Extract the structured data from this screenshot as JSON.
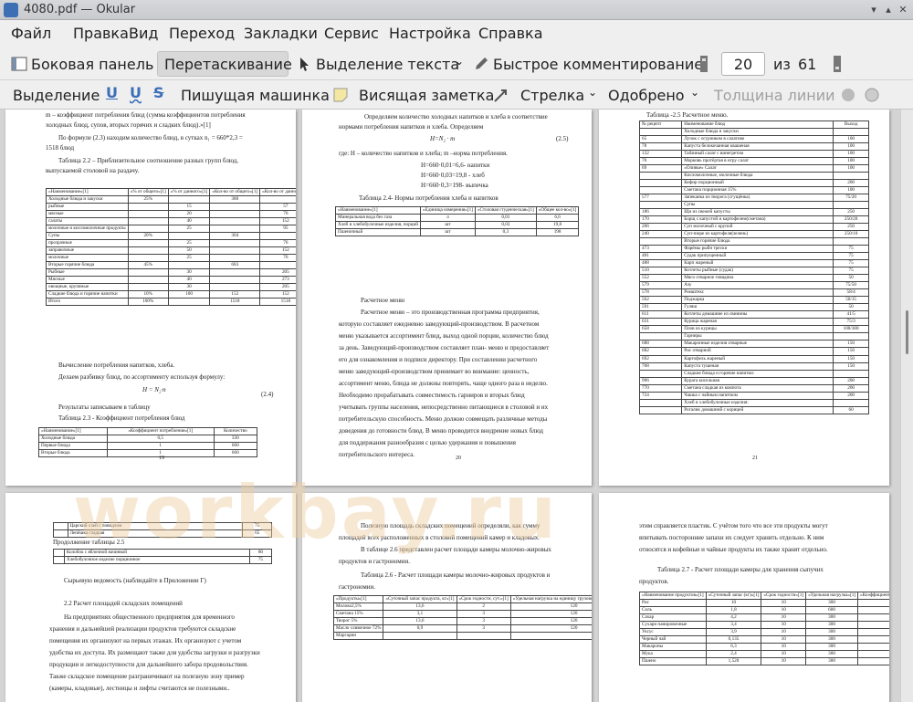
{
  "window": {
    "title": "4080.pdf — Okular"
  },
  "menu": [
    "Файл",
    "Правка",
    "Вид",
    "Переход",
    "Закладки",
    "Сервис",
    "Настройка",
    "Справка"
  ],
  "toolbar1": {
    "sidebar": "Боковая панель",
    "drag": "Перетаскивание",
    "text_select": "Выделение текста",
    "quick_comment": "Быстрое комментирование",
    "page_value": "20",
    "of": "из",
    "total": "61"
  },
  "toolbar2": {
    "select": "Выделение",
    "typewriter": "Пишущая машинка",
    "sticky_note": "Висящая заметка",
    "arrow": "Стрелка",
    "approved": "Одобрено",
    "line_width": "Толщина линии"
  },
  "watermark": "workbay.ru",
  "pages": {
    "p19": {
      "number": "19",
      "l1": "m – коэффициент потребления блюд (сумма коэффициентов потребления",
      "l2": "холодных блюд, супов, вторых горячих и сладких блюд).»[1]",
      "l3": "По формуле (2.3) находим количество блюд, в сутках n₁ = 660*2,3 =",
      "l4": "1518 блюд",
      "l5": "Таблица 2.2 – Приблизительное соотношение разных групп блюд,",
      "l6": "выпускаемой столовой на раздачу.",
      "l7": "Вычисление потребления напитков, хлеба.",
      "l8": "Делаем разбивку блюд, по ассортименту используя формулу:",
      "formula": "H = N₂·n",
      "eq": "(2.4)",
      "l9": "Результаты записываем в таблицу",
      "l10": "Таблица 2.3 - Коэффициент потребления блюд",
      "t22_head": [
        "«Наименование»[1]",
        "«% от общего»[1]",
        "«% от данного»[1]",
        "«Кол-во от общего»[1]",
        "«Кол-во от данного»[1]"
      ],
      "t22_rows": [
        [
          "Холодные блюда и закуски",
          "25%",
          "",
          "380",
          ""
        ],
        [
          "рыбные",
          "",
          "15",
          "",
          "57"
        ],
        [
          "мясные",
          "",
          "20",
          "",
          "76"
        ],
        [
          "салаты",
          "",
          "40",
          "",
          "152"
        ],
        [
          "молочные и кисломолочные продукты",
          "",
          "25",
          "",
          "95"
        ],
        [
          "Супы",
          "20%",
          "",
          "304",
          ""
        ],
        [
          "прозрачные",
          "",
          "25",
          "",
          "76"
        ],
        [
          "заправочные",
          "",
          "50",
          "",
          "152"
        ],
        [
          "молочные",
          "",
          "25",
          "",
          "76"
        ],
        [
          "Вторые горячие блюда",
          "45%",
          "",
          "683",
          ""
        ],
        [
          "Рыбные",
          "",
          "30",
          "",
          "205"
        ],
        [
          "Мясные",
          "",
          "40",
          "",
          "273"
        ],
        [
          "овощные, крупяные",
          "",
          "30",
          "",
          "205"
        ],
        [
          "Сладкие блюда и горячие напитки",
          "10%",
          "100",
          "152",
          "152"
        ],
        [
          "Итого",
          "100%",
          "",
          "1518",
          "1518"
        ]
      ],
      "t23_head": [
        "«Наименование»[1]",
        "«Коэффициент потребления»[1]",
        "Количество"
      ],
      "t23_rows": [
        [
          "Холодные блюда",
          "0,5",
          "330"
        ],
        [
          "Первые блюда",
          "1",
          "660"
        ],
        [
          "Вторые блюда",
          "1",
          "660"
        ]
      ]
    },
    "p20": {
      "number": "20",
      "l1": "Определяем количество холодных напитков и хлеба в соответствие",
      "l2": "нормами потребления напитков и хлеба. Определяем",
      "formula": "H=N₂ · m",
      "eq": "(2.5)",
      "l3": "где: H – количество напитков и хлеба; m –норма потребления.",
      "l4": "H=660·0,01=6,6- напитки",
      "l5": "H=660·0,03=19,8 - хлеб",
      "l6": "H=660·0,3=198- выпечка",
      "l7": "Таблица 2.4- Нормы потребления хлеба и напитков",
      "l8": "Расчетное меню",
      "l9": "Расчетное меню – это производственная программа предприятия,",
      "l10": "которую составляет ежедневно заведующий-производством. В расчетном",
      "l11": "меню указывается ассортимент блюд, выход одной порции, количество блюд",
      "l12": "за день. Заведующий-производством составляет план- меню и предоставляет",
      "l13": "его для ознакомления и подписи директору. При составлении расчетного",
      "l14": "меню заведующий-производством принимает во внимание: ценность,",
      "l15": "ассортимент меню, блюда не должны повторять, чаще одного раза в неделю.",
      "l16": "Необходимо прорабатывать совместимость гарниров и вторых блюд",
      "l17": "учитывать группы населения, непосредственно питающиеся в столовой и их",
      "l18": "потребительскую способность. Меню должно совмещать различные методы",
      "l19": "доведения до готовности блюд. В меню проводится внедрение новых блюд",
      "l20": "для поддержания разнообразия с целью удержания и повышения",
      "l21": "потребительского интереса.",
      "t24_head": [
        "«Наименование»[1]",
        "«Единица измерения»[1]",
        "«Столовая студенческая»[1]",
        "«Общее кол-во»[1]"
      ],
      "t24_rows": [
        [
          "Минеральная вода без газа",
          "л",
          "0,01",
          "6,6"
        ],
        [
          "Хлеб и хлебобулочные изделия, порций",
          "шт",
          "0,03",
          "19,8"
        ],
        [
          "Пшеничный",
          "шт",
          "0,3",
          "198"
        ]
      ]
    },
    "p21": {
      "number": "21",
      "l1": "Таблица -2.5 Расчетное меню.",
      "t25_head": [
        "№ рецепт",
        "Наименование блюд",
        "Выход"
      ],
      "t25_rows": [
        [
          "",
          "Холодные блюда и закуски",
          ""
        ],
        [
          "65",
          "Лучок с огурчиком в салатике",
          "100"
        ],
        [
          "78",
          "Капуста белокочанная квашеная",
          "100"
        ],
        [
          "132",
          "Табачный салат с винегретом",
          "100"
        ],
        [
          "70",
          "Морковь протёртая в игру салат",
          "100"
        ],
        [
          "69",
          "«Оливье» Салат",
          "100"
        ],
        [
          "",
          "Кисломолочные, молочные блюда",
          ""
        ],
        [
          "",
          "Кефир порционный",
          "200"
        ],
        [
          "",
          "Сметана порционная 15%",
          "100"
        ],
        [
          "577",
          "Запеканка из творога (сгущёнка)",
          "75/20"
        ],
        [
          "",
          "Супы",
          ""
        ],
        [
          "186",
          "Щи из свежей капусты",
          "250"
        ],
        [
          "170",
          "Борщ с капустой и картофелем(сметана)",
          "250/20"
        ],
        [
          "206",
          "Суп молочный с крупой",
          "250"
        ],
        [
          "240",
          "Суп-пюре из картофеля(зелень)",
          "250/10"
        ],
        [
          "",
          "Вторые горячие блюда",
          ""
        ],
        [
          "473",
          "Фарёмы рыбн трески",
          "75"
        ],
        [
          "481",
          "Судак припущенный",
          "75"
        ],
        [
          "488",
          "Карп жареный",
          "75"
        ],
        [
          "510",
          "Котлеты рыбные (судак)",
          "75"
        ],
        [
          "552",
          "Мясо отварное говядина",
          "50"
        ],
        [
          "579",
          "Азу",
          "75/50"
        ],
        [
          "578",
          "Ромштекс",
          "58/4"
        ],
        [
          "562",
          "Поджарка",
          "50/15"
        ],
        [
          "591",
          "Гуляш",
          "50"
        ],
        [
          "611",
          "Котлеты домашние из свинины",
          "41/5"
        ],
        [
          "631",
          "Курица жареная",
          "75/3"
        ],
        [
          "658",
          "Плов из курицы",
          "100/300"
        ],
        [
          "",
          "Гарниры",
          ""
        ],
        [
          "688",
          "Макаронные изделия отварные",
          "150"
        ],
        [
          "682",
          "Рис отварной",
          "150"
        ],
        [
          "692",
          "Картофель жареный",
          "150"
        ],
        [
          "708",
          "Капуста тушеная",
          "150"
        ],
        [
          "",
          "Сладкие блюда и горячие напитки:",
          ""
        ],
        [
          "996",
          "Курага кисельная",
          "200"
        ],
        [
          "770",
          "Сметана сладкая из компота",
          "200"
        ],
        [
          "724",
          "Чашка с чайным напитком",
          "200"
        ],
        [
          "",
          "Хлеб и хлебобулочные изделия:",
          ""
        ],
        [
          "",
          "Рогалик домашний с корицей",
          "60"
        ]
      ]
    },
    "p22": {
      "l1": "Продолжение таблицы 2.5",
      "l2": "Сырьевую ведомость (наблюдайте в Приложении Г)",
      "l3": "2.2 Расчет площадей складских помещений",
      "l4": "На предприятиях общественного предприятия для временного",
      "l5": "хранения и дальнейшей реализации продуктов требуются складские",
      "l6": "помещения их организуют на первых этажах. Их организуют с учетом",
      "l7": "удобства их доступа. Их размещают также для удобства загрузки и разгрузки",
      "l8": "продукции и легкодоступности для дальнейшего забора продовольствия.",
      "l9": "Также складское помещение разграничивают на полезную зону пример",
      "l10": "(камеры, кладовые), лестницы и лифты считаются не полезными..",
      "t_top": [
        [
          "",
          "Царский слей с повидлом",
          "75"
        ],
        [
          "",
          "Лепёшка сладкая",
          "65"
        ]
      ],
      "t_cont": [
        [
          "",
          "Колобок с яблочной начинкой",
          "80"
        ],
        [
          "",
          "Хлебобулочное изделие порционное",
          "75"
        ]
      ]
    },
    "p23": {
      "l1": "Полезную площадь складских помещений определяли, как сумму",
      "l2": "площадей всех расположенных в столовой помещений камер и кладовых.",
      "l3": "В таблице 2.6 представлен расчет площади камеры молочно-жировых",
      "l4": "продуктов и гастрономии.",
      "l5": "Таблица 2.6 - Расчет площади камеры молочно-жировых продуктов и",
      "l6": "гастрономии.",
      "t26_head": [
        "«Продукты»[1]",
        "«Суточный запас продукта, кг»[1]",
        "«Срок годности, сут.»[1]",
        "«Удельная нагрузка на единицу грузовой площади, кг/м²»[1]",
        "«Коэффициент увеличения площади»[1]",
        "«Площадь, м²»[1]"
      ],
      "t26_rows": [
        [
          "Молоко2,5%",
          "13,6",
          "2",
          "120",
          "2,2",
          "0,5"
        ],
        [
          "Сметана 15%",
          "3,1",
          "3",
          "120",
          "2,2",
          "0,17"
        ],
        [
          "Творог 5%",
          "13,6",
          "3",
          "120",
          "2,2",
          "0,8"
        ],
        [
          "Масло сливочное 72%",
          "0,9",
          "3",
          "120",
          "2,2",
          "0,05"
        ],
        [
          "Маргарин",
          "",
          "",
          "",
          "",
          ""
        ]
      ]
    },
    "p24": {
      "l1": "этим справляется пластик. С учётом того что все эти продукты могут",
      "l2": "впитывать посторонние запахи их следует хранить отдельно. К ним",
      "l3": "относятся и кофейные и чайные продукты их также хранят отдельно.",
      "l4": "Таблица 2.7 - Расчет площади камеры для хранения сыпучих",
      "l5": "продуктов.",
      "t27_head": [
        "«Наименование продуктов»[1]",
        "«Суточный запас (кг)»[1]",
        "«Срок годности»[1]",
        "«Удельная нагрузка»[1]",
        "«Коэффициент увеличения площади»[1]",
        "«Площадь»[1]"
      ],
      "t27_rows": [
        [
          "Рис",
          "10",
          "10",
          "300",
          "2,2",
          "0,73"
        ],
        [
          "Соль",
          "1,8",
          "10",
          "600",
          "2,2",
          "0,07"
        ],
        [
          "Сахар",
          "4,2",
          "10",
          "300",
          "2,2",
          "0,3"
        ],
        [
          "Сухари панировочные",
          "3,4",
          "10",
          "300",
          "2,2",
          "0,25"
        ],
        [
          "Уксус",
          "3,9",
          "10",
          "300",
          "2,2",
          "0,29"
        ],
        [
          "Черный чай",
          "0,135",
          "10",
          "300",
          "2,2",
          "0,001"
        ],
        [
          "Макароны",
          "6,3",
          "10",
          "300",
          "2,2",
          "0,5"
        ],
        [
          "Мука",
          "2,4",
          "10",
          "300",
          "2,2",
          "0,18"
        ],
        [
          "Пшено",
          "1,520",
          "10",
          "300",
          "2,2",
          "0,11"
        ]
      ]
    }
  }
}
